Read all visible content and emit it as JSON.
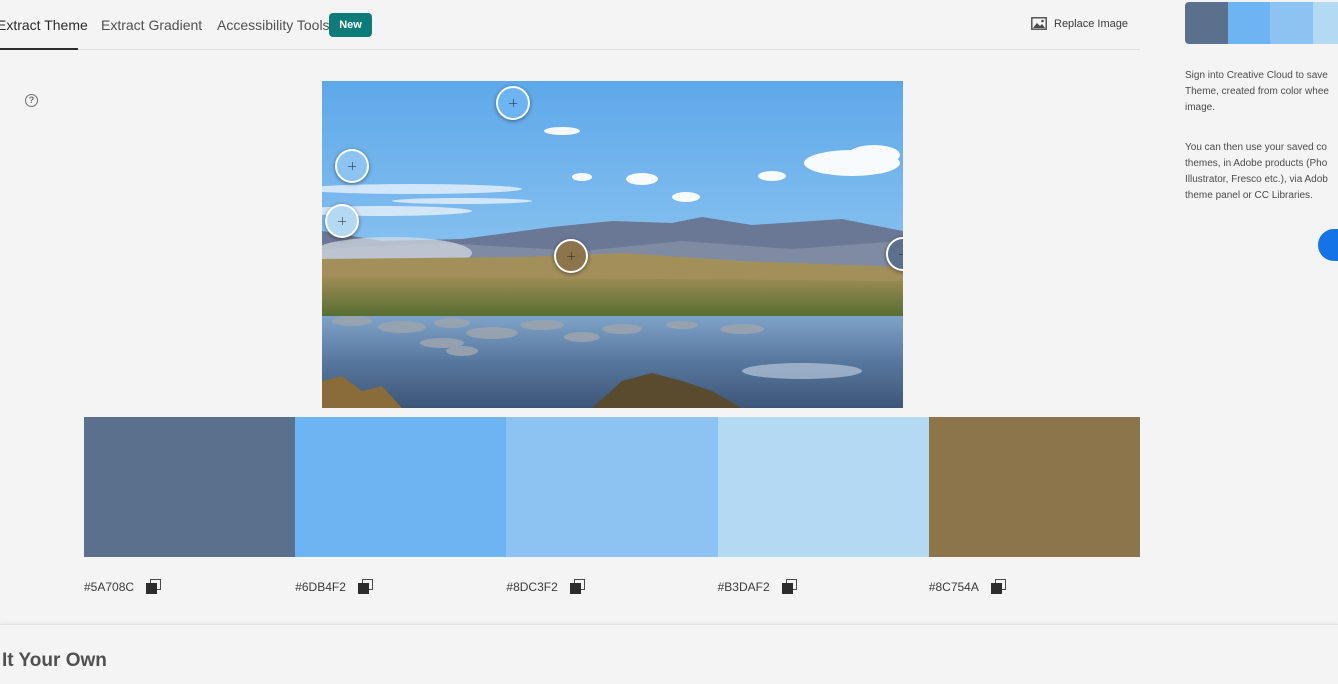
{
  "tabs": [
    {
      "label": "Extract Theme",
      "active": true
    },
    {
      "label": "Extract Gradient",
      "active": false
    },
    {
      "label": "Accessibility Tools",
      "active": false
    }
  ],
  "new_badge": "New",
  "replace_image": "Replace Image",
  "help_glyph": "?",
  "colors": [
    {
      "hex": "#5A708C"
    },
    {
      "hex": "#6DB4F2"
    },
    {
      "hex": "#8DC3F2"
    },
    {
      "hex": "#B3DAF2"
    },
    {
      "hex": "#8C754A"
    }
  ],
  "sidebar": {
    "sign_in_text": "Sign into Creative Cloud to save\nTheme, created from color whee\nimage.",
    "use_text": "You can then use your saved co\nthemes, in Adobe products (Pho\nIllustrator, Fresco etc.), via Adob\ntheme panel or CC Libraries."
  },
  "section_heading": "It Your Own"
}
